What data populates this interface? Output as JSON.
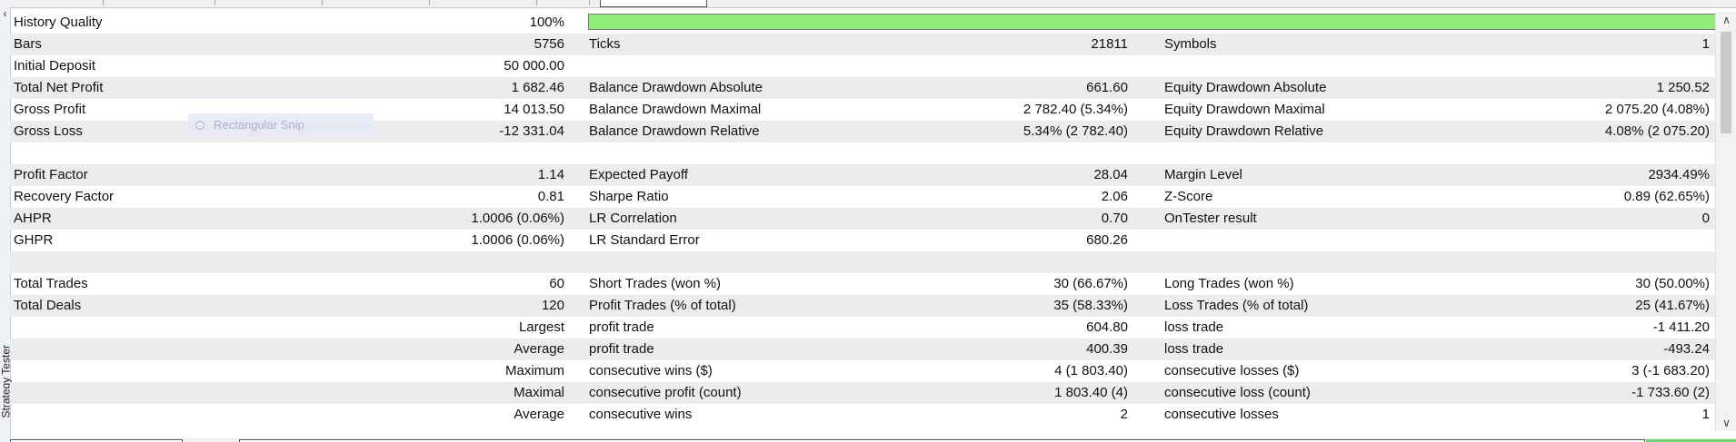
{
  "report": {
    "history_quality": {
      "label": "History Quality",
      "value": "100%",
      "fill_percent": 100
    },
    "rows": [
      {
        "shade": true,
        "l1": "Bars",
        "v1": "5756",
        "l2": "Ticks",
        "v2": "21811",
        "l3": "Symbols",
        "v3": "1"
      },
      {
        "shade": false,
        "l1": "Initial Deposit",
        "v1": "50 000.00",
        "l2": "",
        "v2": "",
        "l3": "",
        "v3": ""
      },
      {
        "shade": true,
        "l1": "Total Net Profit",
        "v1": "1 682.46",
        "l2": "Balance Drawdown Absolute",
        "v2": "661.60",
        "l3": "Equity Drawdown Absolute",
        "v3": "1 250.52"
      },
      {
        "shade": false,
        "l1": "Gross Profit",
        "v1": "14 013.50",
        "l2": "Balance Drawdown Maximal",
        "v2": "2 782.40 (5.34%)",
        "l3": "Equity Drawdown Maximal",
        "v3": "2 075.20 (4.08%)"
      },
      {
        "shade": true,
        "l1": "Gross Loss",
        "v1": "-12 331.04",
        "l2": "Balance Drawdown Relative",
        "v2": "5.34% (2 782.40)",
        "l3": "Equity Drawdown Relative",
        "v3": "4.08% (2 075.20)"
      },
      {
        "shade": false,
        "l1": "",
        "v1": "",
        "l2": "",
        "v2": "",
        "l3": "",
        "v3": ""
      },
      {
        "shade": true,
        "l1": "Profit Factor",
        "v1": "1.14",
        "l2": "Expected Payoff",
        "v2": "28.04",
        "l3": "Margin Level",
        "v3": "2934.49%"
      },
      {
        "shade": false,
        "l1": "Recovery Factor",
        "v1": "0.81",
        "l2": "Sharpe Ratio",
        "v2": "2.06",
        "l3": "Z-Score",
        "v3": "0.89 (62.65%)"
      },
      {
        "shade": true,
        "l1": "AHPR",
        "v1": "1.0006 (0.06%)",
        "l2": "LR Correlation",
        "v2": "0.70",
        "l3": "OnTester result",
        "v3": "0"
      },
      {
        "shade": false,
        "l1": "GHPR",
        "v1": "1.0006 (0.06%)",
        "l2": "LR Standard Error",
        "v2": "680.26",
        "l3": "",
        "v3": ""
      },
      {
        "shade": true,
        "l1": "",
        "v1": "",
        "l2": "",
        "v2": "",
        "l3": "",
        "v3": ""
      },
      {
        "shade": false,
        "l1": "Total Trades",
        "v1": "60",
        "l2": "Short Trades (won %)",
        "v2": "30 (66.67%)",
        "l3": "Long Trades (won %)",
        "v3": "30 (50.00%)"
      },
      {
        "shade": true,
        "l1": "Total Deals",
        "v1": "120",
        "l2": "Profit Trades (% of total)",
        "v2": "35 (58.33%)",
        "l3": "Loss Trades (% of total)",
        "v3": "25 (41.67%)"
      },
      {
        "shade": false,
        "l1": "",
        "v1": "Largest",
        "l2": "profit trade",
        "v2": "604.80",
        "l3": "loss trade",
        "v3": "-1 411.20"
      },
      {
        "shade": true,
        "l1": "",
        "v1": "Average",
        "l2": "profit trade",
        "v2": "400.39",
        "l3": "loss trade",
        "v3": "-493.24"
      },
      {
        "shade": false,
        "l1": "",
        "v1": "Maximum",
        "l2": "consecutive wins ($)",
        "v2": "4 (1 803.40)",
        "l3": "consecutive losses ($)",
        "v3": "3 (-1 683.20)"
      },
      {
        "shade": true,
        "l1": "",
        "v1": "Maximal",
        "l2": "consecutive profit (count)",
        "v2": "1 803.40 (4)",
        "l3": "consecutive loss (count)",
        "v3": "-1 733.60 (2)"
      },
      {
        "shade": false,
        "l1": "",
        "v1": "Average",
        "l2": "consecutive wins",
        "v2": "2",
        "l3": "consecutive losses",
        "v3": "1"
      }
    ]
  },
  "overlay": {
    "snip_text": "Rectangular Snip"
  },
  "side_tab": {
    "label": "Strategy Tester"
  },
  "colors": {
    "quality_fill": "#90ee78",
    "row_shade": "#ececec"
  }
}
